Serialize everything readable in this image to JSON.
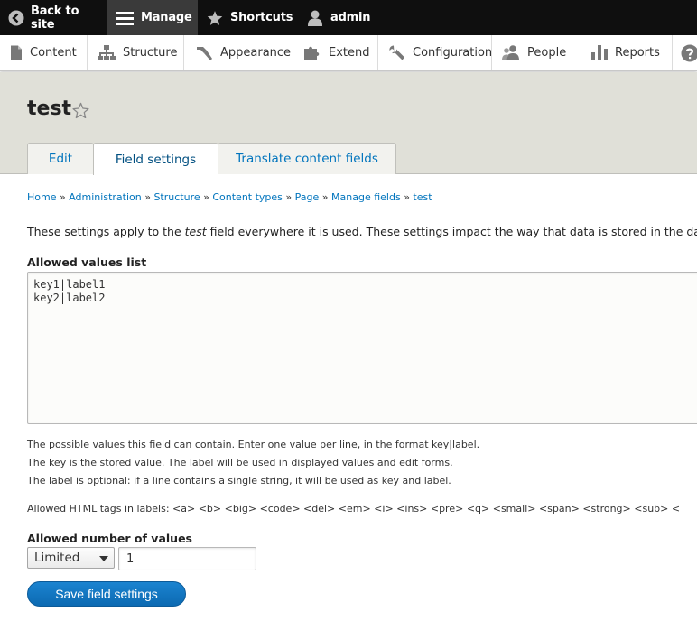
{
  "toolbar": {
    "back_label": "Back to site",
    "manage_label": "Manage",
    "shortcuts_label": "Shortcuts",
    "user_label": "admin"
  },
  "tray": {
    "items": [
      {
        "label": "Content",
        "icon": "file-icon"
      },
      {
        "label": "Structure",
        "icon": "sitemap-icon"
      },
      {
        "label": "Appearance",
        "icon": "paintbrush-icon"
      },
      {
        "label": "Extend",
        "icon": "puzzle-icon"
      },
      {
        "label": "Configuration",
        "icon": "wrench-icon"
      },
      {
        "label": "People",
        "icon": "people-icon"
      },
      {
        "label": "Reports",
        "icon": "bar-chart-icon"
      }
    ]
  },
  "page": {
    "title": "test"
  },
  "tabs": [
    {
      "label": "Edit",
      "active": false
    },
    {
      "label": "Field settings",
      "active": true
    },
    {
      "label": "Translate content fields",
      "active": false
    }
  ],
  "breadcrumb": {
    "items": [
      "Home",
      "Administration",
      "Structure",
      "Content types",
      "Page",
      "Manage fields",
      "test"
    ],
    "separator": "»"
  },
  "description": {
    "before": "These settings apply to the ",
    "field": "test",
    "after": " field everywhere it is used. These settings impact the way that data is stored in the da"
  },
  "allowed_values": {
    "label": "Allowed values list",
    "value": "key1|label1\nkey2|label2",
    "help": [
      "The possible values this field can contain. Enter one value per line, in the format key|label.",
      "The key is the stored value. The label will be used in displayed values and edit forms.",
      "The label is optional: if a line contains a single string, it will be used as key and label."
    ],
    "tags_help": "Allowed HTML tags in labels: <a> <b> <big> <code> <del> <em> <i> <ins> <pre> <q> <small> <span> <strong> <sub> <"
  },
  "cardinality": {
    "label": "Allowed number of values",
    "selected": "Limited",
    "number": "1"
  },
  "actions": {
    "save_label": "Save field settings"
  },
  "colors": {
    "toolbar_bg": "#0f0f0f",
    "link": "#0074bd",
    "button": "#1b84d0",
    "header_bg": "#e0e0d8"
  }
}
